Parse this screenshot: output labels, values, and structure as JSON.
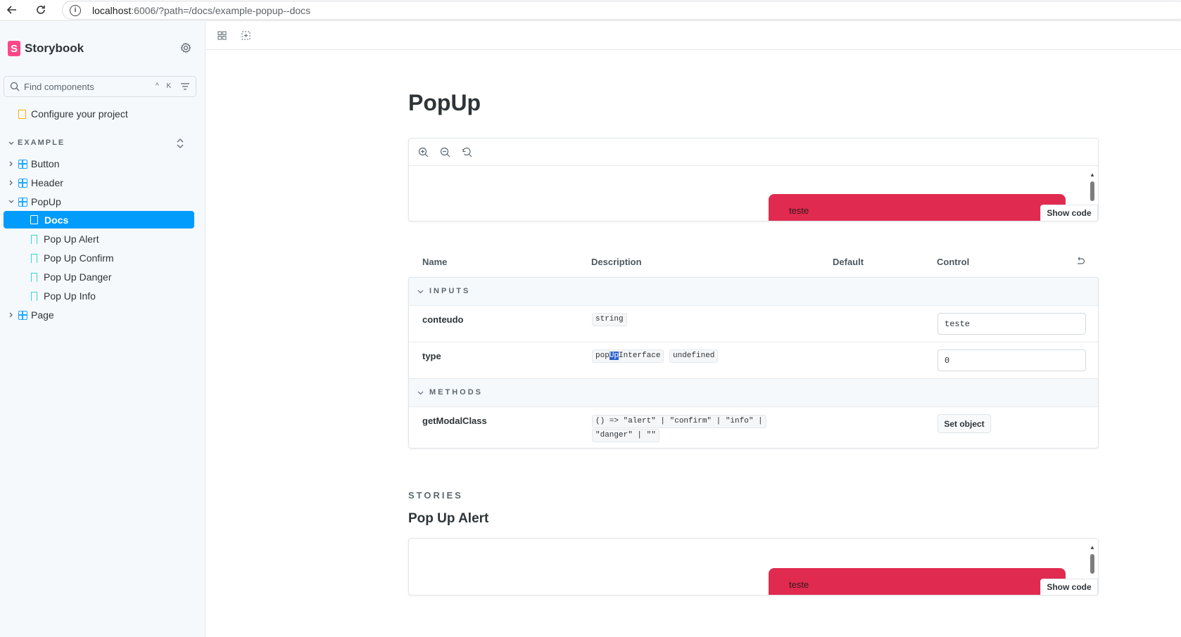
{
  "browser": {
    "url_host": "localhost",
    "url_rest": ":6006/?path=/docs/example-popup--docs"
  },
  "sidebar": {
    "brand": "Storybook",
    "search_placeholder": "Find components",
    "shortcut": "^ K",
    "configure": "Configure your project",
    "section": "EXAMPLE",
    "items": [
      {
        "label": "Button"
      },
      {
        "label": "Header"
      },
      {
        "label": "PopUp"
      },
      {
        "label": "Docs"
      },
      {
        "label": "Pop Up Alert"
      },
      {
        "label": "Pop Up Confirm"
      },
      {
        "label": "Pop Up Danger"
      },
      {
        "label": "Pop Up Info"
      },
      {
        "label": "Page"
      }
    ]
  },
  "docs": {
    "title": "PopUp",
    "preview_text": "teste",
    "show_code": "Show code",
    "table": {
      "headers": {
        "name": "Name",
        "description": "Description",
        "default": "Default",
        "control": "Control"
      },
      "groups": {
        "inputs": "INPUTS",
        "methods": "METHODS"
      },
      "rows": [
        {
          "name": "conteudo",
          "type": "string",
          "control_value": "teste"
        },
        {
          "name": "type",
          "type_a_pre": "pop",
          "type_a_hl": "Up",
          "type_a_post": "Interface",
          "type_b": "undefined",
          "control_value": "0"
        },
        {
          "name": "getModalClass",
          "sig_line1": "() => \"alert\" | \"confirm\" | \"info\" |",
          "sig_line2": "\"danger\" | \"\"",
          "control_button": "Set object"
        }
      ]
    },
    "stories_label": "STORIES",
    "story_title": "Pop Up Alert",
    "story_preview_text": "teste"
  },
  "colors": {
    "accent": "#029cfd",
    "popup_red": "#e12a4f",
    "brand_pink": "#ff4785"
  }
}
